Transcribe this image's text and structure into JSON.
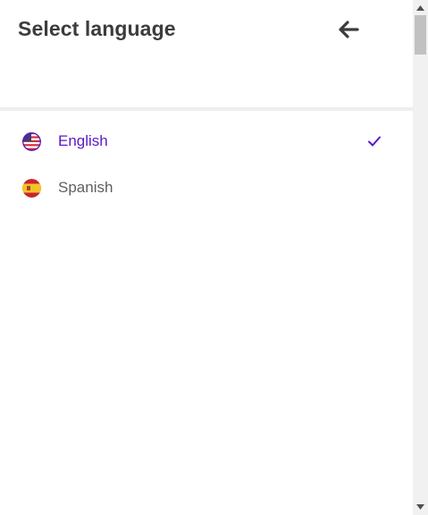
{
  "header": {
    "title": "Select language",
    "back_icon": "arrow-left-icon"
  },
  "languages": [
    {
      "label": "English",
      "flag_icon": "us-flag-icon",
      "selected": true
    },
    {
      "label": "Spanish",
      "flag_icon": "spain-flag-icon",
      "selected": false
    }
  ],
  "colors": {
    "accent": "#5a17c9",
    "title": "#3c3c3c",
    "text": "#5f5f5f",
    "divider": "#eeeeee"
  }
}
